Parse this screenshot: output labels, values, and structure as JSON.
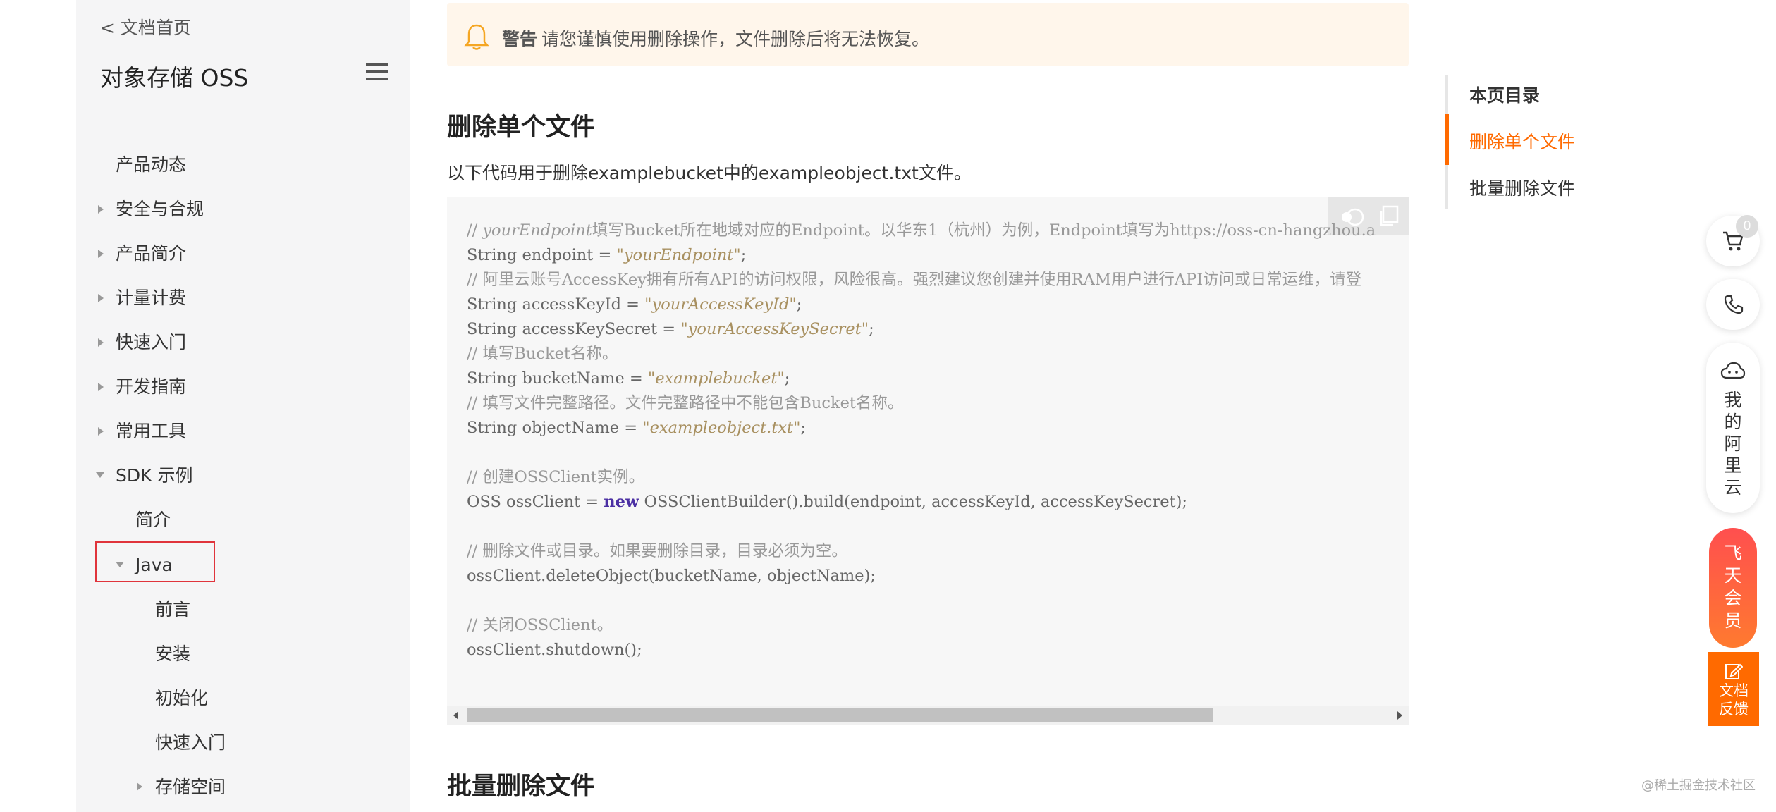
{
  "sidebar": {
    "back_link": "< 文档首页",
    "title": "对象存储 OSS",
    "items": [
      {
        "label": "产品动态"
      },
      {
        "label": "安全与合规"
      },
      {
        "label": "产品简介"
      },
      {
        "label": "计量计费"
      },
      {
        "label": "快速入门"
      },
      {
        "label": "开发指南"
      },
      {
        "label": "常用工具"
      },
      {
        "label": "SDK 示例"
      },
      {
        "label": "简介"
      },
      {
        "label": "Java"
      },
      {
        "label": "前言"
      },
      {
        "label": "安装"
      },
      {
        "label": "初始化"
      },
      {
        "label": "快速入门"
      },
      {
        "label": "存储空间"
      }
    ]
  },
  "warning": {
    "label": "警告",
    "text": "请您谨慎使用删除操作，文件删除后将无法恢复。"
  },
  "content": {
    "section1_title": "删除单个文件",
    "section1_desc": "以下代码用于删除examplebucket中的exampleobject.txt文件。",
    "section2_title": "批量删除文件"
  },
  "code": {
    "c1_prefix": "// ",
    "c1_italic": "yourEndpoint",
    "c1_rest": "填写Bucket所在地域对应的Endpoint。以华东1（杭州）为例，Endpoint填写为https://oss-cn-hangzhou.a",
    "l2_a": "String endpoint = ",
    "l2_str": "\"yourEndpoint\"",
    "l2_b": ";",
    "c3": "// 阿里云账号AccessKey拥有所有API的访问权限，风险很高。强烈建议您创建并使用RAM用户进行API访问或日常运维，请登",
    "l4_a": "String accessKeyId = ",
    "l4_str": "\"yourAccessKeyId\"",
    "l4_b": ";",
    "l5_a": "String accessKeySecret = ",
    "l5_str": "\"yourAccessKeySecret\"",
    "l5_b": ";",
    "c6": "// 填写Bucket名称。",
    "l7_a": "String bucketName = ",
    "l7_str": "\"examplebucket\"",
    "l7_b": ";",
    "c8": "// 填写文件完整路径。文件完整路径中不能包含Bucket名称。",
    "l9_a": "String objectName = ",
    "l9_str": "\"exampleobject.txt\"",
    "l9_b": ";",
    "c11": "// 创建OSSClient实例。",
    "l12_a": "OSS ossClient = ",
    "l12_kw": "new",
    "l12_b": " OSSClientBuilder().build(endpoint, accessKeyId, accessKeySecret);",
    "c14": "// 删除文件或目录。如果要删除目录，目录必须为空。",
    "l15": "ossClient.deleteObject(bucketName, objectName);",
    "c17": "// 关闭OSSClient。",
    "l18": "ossClient.shutdown();"
  },
  "toc": {
    "title": "本页目录",
    "items": [
      {
        "label": "删除单个文件"
      },
      {
        "label": "批量删除文件"
      }
    ]
  },
  "float": {
    "cart_count": "0",
    "my_aliyun": [
      "我",
      "的",
      "阿",
      "里",
      "云"
    ],
    "vip": [
      "飞",
      "天",
      "会",
      "员"
    ],
    "feedback": [
      "文档",
      "反馈"
    ]
  },
  "watermark": "@稀土掘金技术社区",
  "colors": {
    "accent": "#ff6a00",
    "warning_bg": "#fff6eb",
    "highlight_border": "#e0343c"
  }
}
